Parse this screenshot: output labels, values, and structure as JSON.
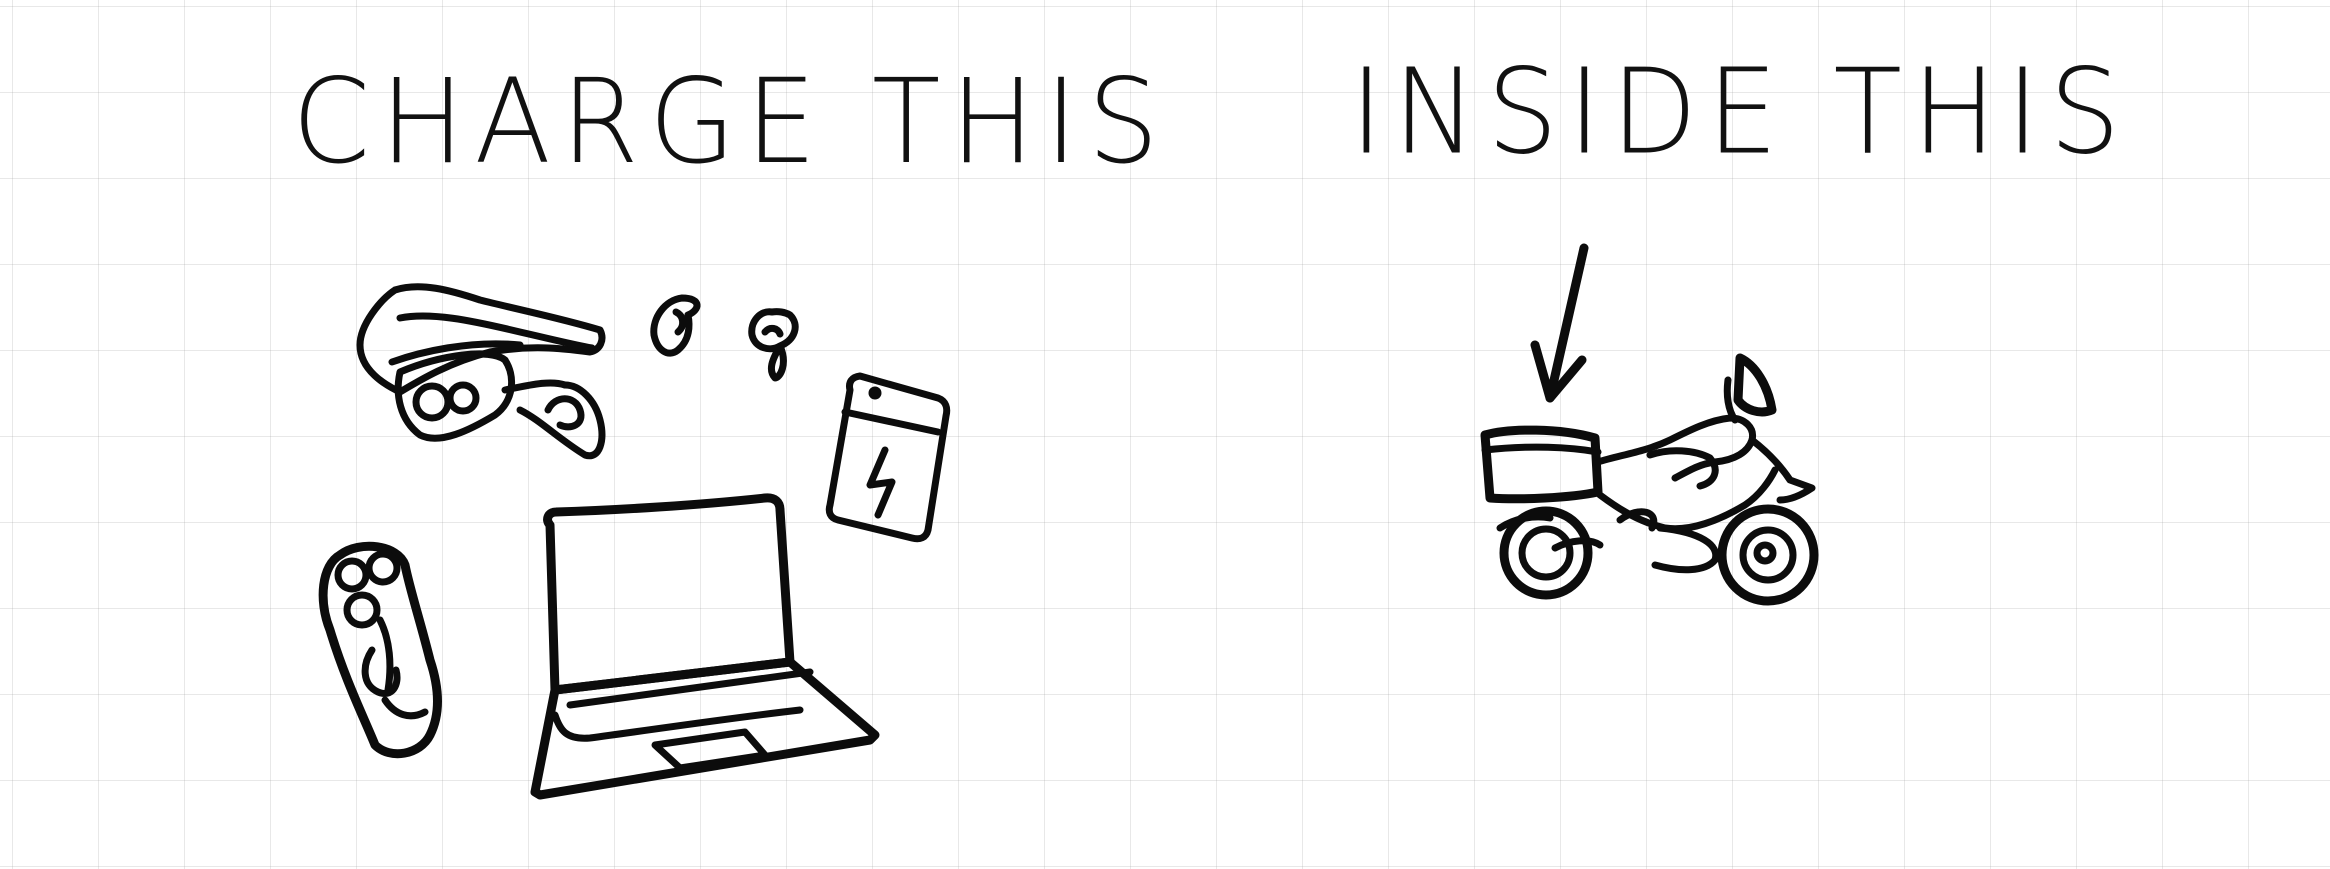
{
  "left_panel": {
    "heading": "CHARGE THIS",
    "items": [
      "headlamp-icon",
      "earbuds-icon",
      "power-bank-icon",
      "laptop-icon",
      "shaver-icon"
    ]
  },
  "right_panel": {
    "heading": "INSIDE THIS",
    "items": [
      "arrow-down-icon",
      "motorcycle-icon"
    ]
  },
  "colors": {
    "ink": "#0c0c0c",
    "paper": "#ffffff",
    "grid": "#cfcfcf"
  }
}
